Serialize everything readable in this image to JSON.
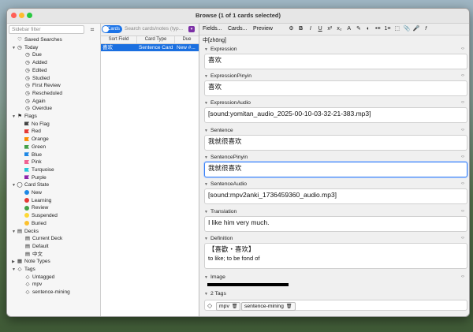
{
  "window": {
    "title": "Browse (1 of 1 cards selected)"
  },
  "sidebar": {
    "filter_placeholder": "Sidebar filter",
    "mode_icon": "⌗",
    "items": [
      {
        "label": "Saved Searches",
        "indent": 0,
        "icon": "♡",
        "arrow": ""
      },
      {
        "label": "Today",
        "indent": 0,
        "icon": "◷",
        "arrow": "▼"
      },
      {
        "label": "Due",
        "indent": 1,
        "icon": "◷",
        "arrow": ""
      },
      {
        "label": "Added",
        "indent": 1,
        "icon": "◷",
        "arrow": ""
      },
      {
        "label": "Edited",
        "indent": 1,
        "icon": "◷",
        "arrow": ""
      },
      {
        "label": "Studied",
        "indent": 1,
        "icon": "◷",
        "arrow": ""
      },
      {
        "label": "First Review",
        "indent": 1,
        "icon": "◷",
        "arrow": ""
      },
      {
        "label": "Rescheduled",
        "indent": 1,
        "icon": "◷",
        "arrow": ""
      },
      {
        "label": "Again",
        "indent": 1,
        "icon": "◷",
        "arrow": ""
      },
      {
        "label": "Overdue",
        "indent": 1,
        "icon": "◷",
        "arrow": ""
      },
      {
        "label": "Flags",
        "indent": 0,
        "icon": "⚑",
        "arrow": "▼"
      },
      {
        "label": "No Flag",
        "indent": 1,
        "flag": "#444444"
      },
      {
        "label": "Red",
        "indent": 1,
        "flag": "#e53935"
      },
      {
        "label": "Orange",
        "indent": 1,
        "flag": "#fb8c00"
      },
      {
        "label": "Green",
        "indent": 1,
        "flag": "#43a047"
      },
      {
        "label": "Blue",
        "indent": 1,
        "flag": "#1e88e5"
      },
      {
        "label": "Pink",
        "indent": 1,
        "flag": "#f06292"
      },
      {
        "label": "Turquoise",
        "indent": 1,
        "flag": "#26c6da"
      },
      {
        "label": "Purple",
        "indent": 1,
        "flag": "#8e24aa"
      },
      {
        "label": "Card State",
        "indent": 0,
        "icon": "◯",
        "arrow": "▼"
      },
      {
        "label": "New",
        "indent": 1,
        "dot": "#1e88e5"
      },
      {
        "label": "Learning",
        "indent": 1,
        "dot": "#e53935"
      },
      {
        "label": "Review",
        "indent": 1,
        "dot": "#43a047"
      },
      {
        "label": "Suspended",
        "indent": 1,
        "dot": "#fdd835"
      },
      {
        "label": "Buried",
        "indent": 1,
        "dot": "#fbc02d"
      },
      {
        "label": "Decks",
        "indent": 0,
        "icon": "▤",
        "arrow": "▼"
      },
      {
        "label": "Current Deck",
        "indent": 1,
        "icon": "▤",
        "arrow": ""
      },
      {
        "label": "Default",
        "indent": 1,
        "icon": "▤",
        "arrow": ""
      },
      {
        "label": "中文",
        "indent": 1,
        "icon": "▤",
        "arrow": ""
      },
      {
        "label": "Note Types",
        "indent": 0,
        "icon": "▦",
        "arrow": "▶"
      },
      {
        "label": "Tags",
        "indent": 0,
        "icon": "◇",
        "arrow": "▼"
      },
      {
        "label": "Untagged",
        "indent": 1,
        "icon": "◇",
        "arrow": ""
      },
      {
        "label": "mpv",
        "indent": 1,
        "icon": "◇",
        "arrow": ""
      },
      {
        "label": "sentence-mining",
        "indent": 1,
        "icon": "◇",
        "arrow": ""
      }
    ]
  },
  "cardlist": {
    "toggle_label": "Cards",
    "search_placeholder": "Search cards/notes (typ...",
    "search_btn_icon": "▾",
    "columns": [
      "Sort Field",
      "Card Type",
      "Due"
    ],
    "rows": [
      [
        "喜欢",
        "Sentence Card",
        "New #..."
      ]
    ]
  },
  "editor": {
    "toolbar": {
      "fields": "Fields...",
      "cards": "Cards...",
      "preview": "Preview"
    },
    "toolbar_icons": [
      "⚙",
      "B",
      "I",
      "U",
      "x²",
      "x₂",
      "A",
      "✎",
      "◐",
      "•≡",
      "1≡",
      "⬚",
      "📎",
      "🎤",
      "𝑓"
    ],
    "pinyin_top": "中[zhōng]",
    "fields": [
      {
        "name": "Expression",
        "value": "喜欢"
      },
      {
        "name": "ExpressionPinyin",
        "value": "喜欢"
      },
      {
        "name": "ExpressionAudio",
        "value": "[sound:yomitan_audio_2025-00-10-03-32-21-383.mp3]"
      },
      {
        "name": "Sentence",
        "value": "我就很喜欢"
      },
      {
        "name": "SentencePinyin",
        "value": "我就很喜欢"
      },
      {
        "name": "SentenceAudio",
        "value": "[sound:mpv2anki_1736459360_audio.mp3]"
      },
      {
        "name": "Translation",
        "value": "I like him very much."
      },
      {
        "name": "Definition",
        "value": "【喜歡・喜欢】",
        "value2": "to like; to be fond of"
      },
      {
        "name": "Image",
        "value": ""
      }
    ],
    "field_code_icon": "‹›",
    "tags_header": "2 Tags",
    "tags": [
      "mpv",
      "sentence-mining"
    ],
    "tag_delete_icon": "🗑",
    "tag_icon": "◇"
  }
}
